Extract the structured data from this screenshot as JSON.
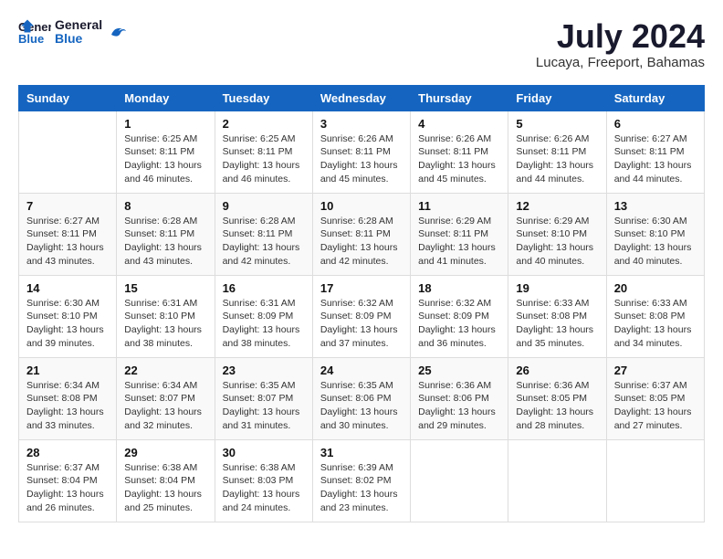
{
  "header": {
    "logo_general": "General",
    "logo_blue": "Blue",
    "month_year": "July 2024",
    "location": "Lucaya, Freeport, Bahamas"
  },
  "days_of_week": [
    "Sunday",
    "Monday",
    "Tuesday",
    "Wednesday",
    "Thursday",
    "Friday",
    "Saturday"
  ],
  "weeks": [
    [
      {
        "day": "",
        "sunrise": "",
        "sunset": "",
        "daylight": ""
      },
      {
        "day": "1",
        "sunrise": "Sunrise: 6:25 AM",
        "sunset": "Sunset: 8:11 PM",
        "daylight": "Daylight: 13 hours and 46 minutes."
      },
      {
        "day": "2",
        "sunrise": "Sunrise: 6:25 AM",
        "sunset": "Sunset: 8:11 PM",
        "daylight": "Daylight: 13 hours and 46 minutes."
      },
      {
        "day": "3",
        "sunrise": "Sunrise: 6:26 AM",
        "sunset": "Sunset: 8:11 PM",
        "daylight": "Daylight: 13 hours and 45 minutes."
      },
      {
        "day": "4",
        "sunrise": "Sunrise: 6:26 AM",
        "sunset": "Sunset: 8:11 PM",
        "daylight": "Daylight: 13 hours and 45 minutes."
      },
      {
        "day": "5",
        "sunrise": "Sunrise: 6:26 AM",
        "sunset": "Sunset: 8:11 PM",
        "daylight": "Daylight: 13 hours and 44 minutes."
      },
      {
        "day": "6",
        "sunrise": "Sunrise: 6:27 AM",
        "sunset": "Sunset: 8:11 PM",
        "daylight": "Daylight: 13 hours and 44 minutes."
      }
    ],
    [
      {
        "day": "7",
        "sunrise": "Sunrise: 6:27 AM",
        "sunset": "Sunset: 8:11 PM",
        "daylight": "Daylight: 13 hours and 43 minutes."
      },
      {
        "day": "8",
        "sunrise": "Sunrise: 6:28 AM",
        "sunset": "Sunset: 8:11 PM",
        "daylight": "Daylight: 13 hours and 43 minutes."
      },
      {
        "day": "9",
        "sunrise": "Sunrise: 6:28 AM",
        "sunset": "Sunset: 8:11 PM",
        "daylight": "Daylight: 13 hours and 42 minutes."
      },
      {
        "day": "10",
        "sunrise": "Sunrise: 6:28 AM",
        "sunset": "Sunset: 8:11 PM",
        "daylight": "Daylight: 13 hours and 42 minutes."
      },
      {
        "day": "11",
        "sunrise": "Sunrise: 6:29 AM",
        "sunset": "Sunset: 8:11 PM",
        "daylight": "Daylight: 13 hours and 41 minutes."
      },
      {
        "day": "12",
        "sunrise": "Sunrise: 6:29 AM",
        "sunset": "Sunset: 8:10 PM",
        "daylight": "Daylight: 13 hours and 40 minutes."
      },
      {
        "day": "13",
        "sunrise": "Sunrise: 6:30 AM",
        "sunset": "Sunset: 8:10 PM",
        "daylight": "Daylight: 13 hours and 40 minutes."
      }
    ],
    [
      {
        "day": "14",
        "sunrise": "Sunrise: 6:30 AM",
        "sunset": "Sunset: 8:10 PM",
        "daylight": "Daylight: 13 hours and 39 minutes."
      },
      {
        "day": "15",
        "sunrise": "Sunrise: 6:31 AM",
        "sunset": "Sunset: 8:10 PM",
        "daylight": "Daylight: 13 hours and 38 minutes."
      },
      {
        "day": "16",
        "sunrise": "Sunrise: 6:31 AM",
        "sunset": "Sunset: 8:09 PM",
        "daylight": "Daylight: 13 hours and 38 minutes."
      },
      {
        "day": "17",
        "sunrise": "Sunrise: 6:32 AM",
        "sunset": "Sunset: 8:09 PM",
        "daylight": "Daylight: 13 hours and 37 minutes."
      },
      {
        "day": "18",
        "sunrise": "Sunrise: 6:32 AM",
        "sunset": "Sunset: 8:09 PM",
        "daylight": "Daylight: 13 hours and 36 minutes."
      },
      {
        "day": "19",
        "sunrise": "Sunrise: 6:33 AM",
        "sunset": "Sunset: 8:08 PM",
        "daylight": "Daylight: 13 hours and 35 minutes."
      },
      {
        "day": "20",
        "sunrise": "Sunrise: 6:33 AM",
        "sunset": "Sunset: 8:08 PM",
        "daylight": "Daylight: 13 hours and 34 minutes."
      }
    ],
    [
      {
        "day": "21",
        "sunrise": "Sunrise: 6:34 AM",
        "sunset": "Sunset: 8:08 PM",
        "daylight": "Daylight: 13 hours and 33 minutes."
      },
      {
        "day": "22",
        "sunrise": "Sunrise: 6:34 AM",
        "sunset": "Sunset: 8:07 PM",
        "daylight": "Daylight: 13 hours and 32 minutes."
      },
      {
        "day": "23",
        "sunrise": "Sunrise: 6:35 AM",
        "sunset": "Sunset: 8:07 PM",
        "daylight": "Daylight: 13 hours and 31 minutes."
      },
      {
        "day": "24",
        "sunrise": "Sunrise: 6:35 AM",
        "sunset": "Sunset: 8:06 PM",
        "daylight": "Daylight: 13 hours and 30 minutes."
      },
      {
        "day": "25",
        "sunrise": "Sunrise: 6:36 AM",
        "sunset": "Sunset: 8:06 PM",
        "daylight": "Daylight: 13 hours and 29 minutes."
      },
      {
        "day": "26",
        "sunrise": "Sunrise: 6:36 AM",
        "sunset": "Sunset: 8:05 PM",
        "daylight": "Daylight: 13 hours and 28 minutes."
      },
      {
        "day": "27",
        "sunrise": "Sunrise: 6:37 AM",
        "sunset": "Sunset: 8:05 PM",
        "daylight": "Daylight: 13 hours and 27 minutes."
      }
    ],
    [
      {
        "day": "28",
        "sunrise": "Sunrise: 6:37 AM",
        "sunset": "Sunset: 8:04 PM",
        "daylight": "Daylight: 13 hours and 26 minutes."
      },
      {
        "day": "29",
        "sunrise": "Sunrise: 6:38 AM",
        "sunset": "Sunset: 8:04 PM",
        "daylight": "Daylight: 13 hours and 25 minutes."
      },
      {
        "day": "30",
        "sunrise": "Sunrise: 6:38 AM",
        "sunset": "Sunset: 8:03 PM",
        "daylight": "Daylight: 13 hours and 24 minutes."
      },
      {
        "day": "31",
        "sunrise": "Sunrise: 6:39 AM",
        "sunset": "Sunset: 8:02 PM",
        "daylight": "Daylight: 13 hours and 23 minutes."
      },
      {
        "day": "",
        "sunrise": "",
        "sunset": "",
        "daylight": ""
      },
      {
        "day": "",
        "sunrise": "",
        "sunset": "",
        "daylight": ""
      },
      {
        "day": "",
        "sunrise": "",
        "sunset": "",
        "daylight": ""
      }
    ]
  ]
}
